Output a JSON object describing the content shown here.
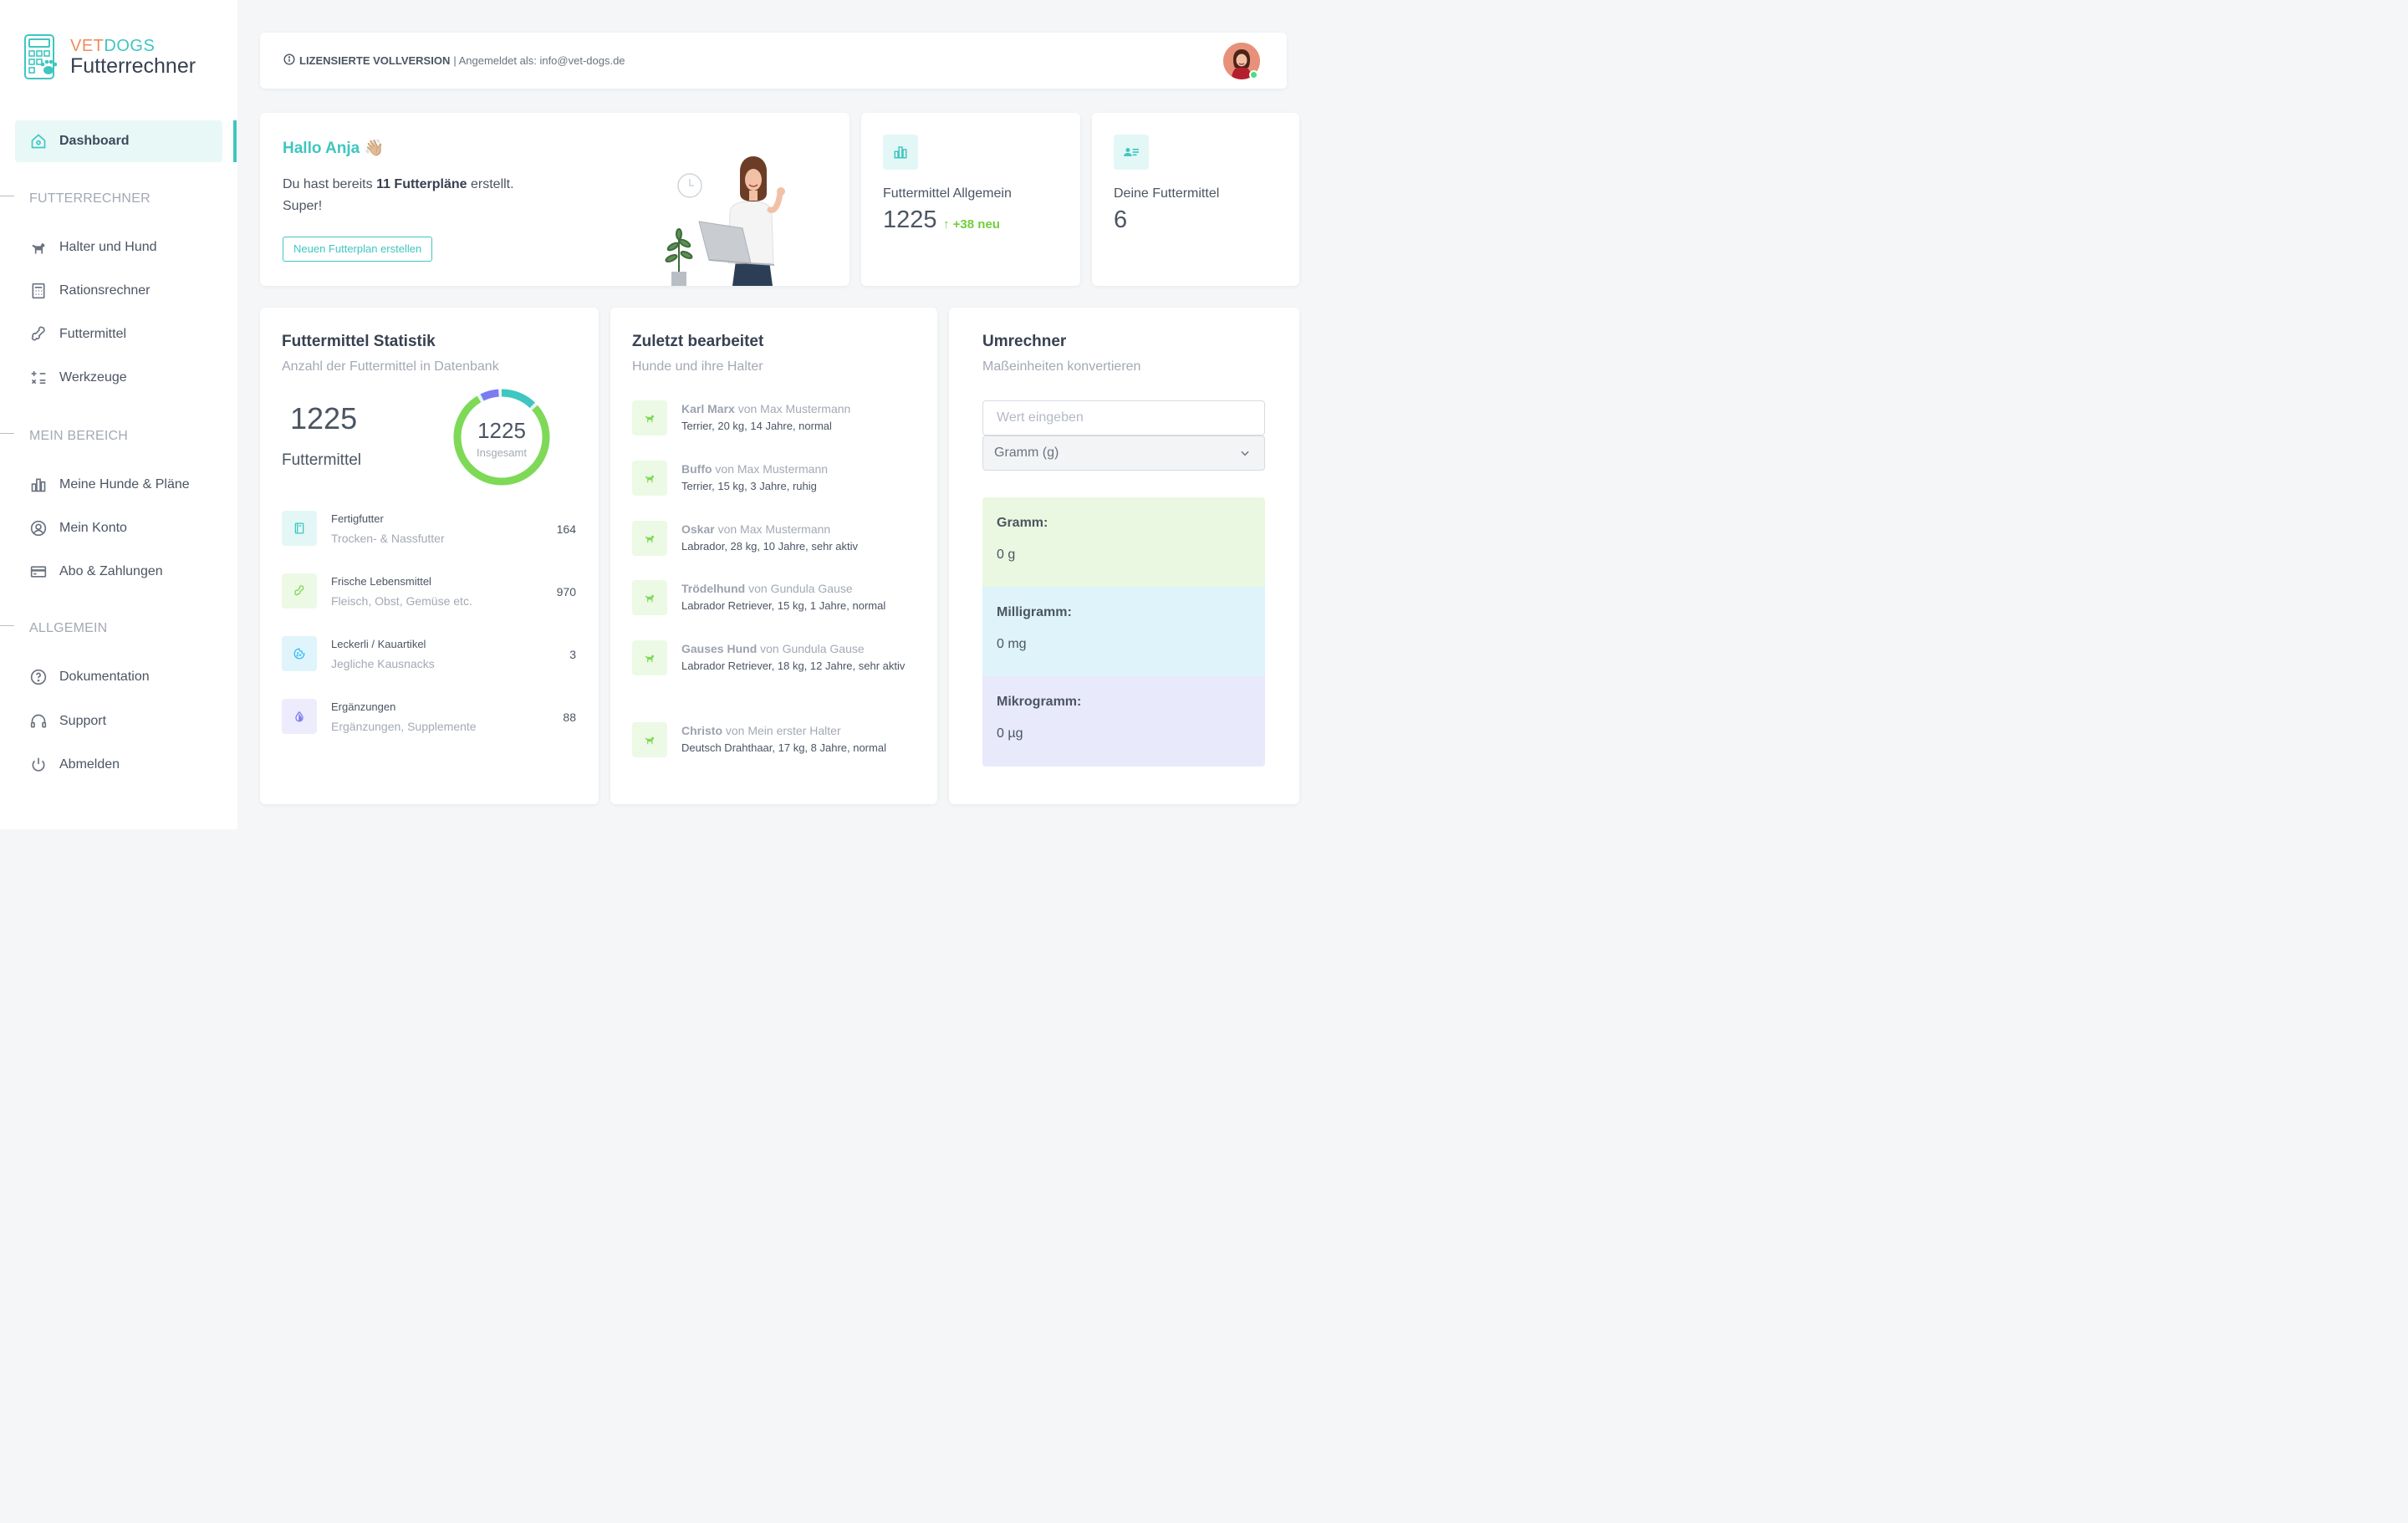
{
  "app": {
    "brand_vet": "VET",
    "brand_dogs": "DOGS",
    "brand_title": "Futterrechner"
  },
  "sidebar": {
    "dashboard_label": "Dashboard",
    "section_futterrechner": "FUTTERRECHNER",
    "section_mein_bereich": "MEIN BEREICH",
    "section_allgemein": "ALLGEMEIN",
    "items": [
      {
        "label": "Halter und Hund",
        "icon": "dog-icon"
      },
      {
        "label": "Rationsrechner",
        "icon": "calculator-icon"
      },
      {
        "label": "Futtermittel",
        "icon": "bone-icon"
      },
      {
        "label": "Werkzeuge",
        "icon": "math-tools-icon"
      },
      {
        "label": "Meine Hunde & Pläne",
        "icon": "bar-chart-icon"
      },
      {
        "label": "Mein Konto",
        "icon": "user-circle-icon"
      },
      {
        "label": "Abo & Zahlungen",
        "icon": "credit-card-icon"
      },
      {
        "label": "Dokumentation",
        "icon": "help-circle-icon"
      },
      {
        "label": "Support",
        "icon": "headset-icon"
      },
      {
        "label": "Abmelden",
        "icon": "power-icon"
      }
    ]
  },
  "topbar": {
    "license": "LIZENSIERTE VOLLVERSION",
    "login_text": "| Angemeldet als: info@vet-dogs.de"
  },
  "welcome": {
    "greeting": "Hallo Anja",
    "emoji": "👋🏼",
    "text_before": "Du hast bereits ",
    "text_bold": "11 Futterpläne",
    "text_after": " erstellt.",
    "text_line2": "Super!",
    "button": "Neuen Futterplan erstellen"
  },
  "stats": {
    "general_label": "Futtermittel Allgemein",
    "general_value": "1225",
    "general_delta": "+38 neu",
    "own_label": "Deine Futtermittel",
    "own_value": "6"
  },
  "statistik": {
    "title": "Futtermittel Statistik",
    "subtitle": "Anzahl der Futtermittel in Datenbank",
    "total": "1225",
    "total_label": "Futtermittel",
    "donut_total": "1225",
    "donut_label": "Insgesamt",
    "categories": [
      {
        "name": "Fertigfutter",
        "desc": "Trocken- & Nassfutter",
        "count": "164",
        "color": "#3fc6c0",
        "bg": "#e3f7f6",
        "icon": "book-icon"
      },
      {
        "name": "Frische Lebensmittel",
        "desc": "Fleisch, Obst, Gemüse etc.",
        "count": "970",
        "color": "#7ed957",
        "bg": "#ecf9e5",
        "icon": "bone-icon"
      },
      {
        "name": "Leckerli / Kauartikel",
        "desc": "Jegliche Kausnacks",
        "count": "3",
        "color": "#38bdf8",
        "bg": "#e0f4fb",
        "icon": "cookie-icon"
      },
      {
        "name": "Ergänzungen",
        "desc": "Ergänzungen, Supplemente",
        "count": "88",
        "color": "#7c7cf0",
        "bg": "#ececfd",
        "icon": "drop-icon"
      }
    ]
  },
  "recent": {
    "title": "Zuletzt bearbeitet",
    "subtitle": "Hunde und ihre Halter",
    "items": [
      {
        "dog": "Karl Marx",
        "owner": " von Max Mustermann",
        "details": "Terrier, 20 kg, 14 Jahre, normal"
      },
      {
        "dog": "Buffo",
        "owner": " von Max Mustermann",
        "details": "Terrier, 15 kg, 3 Jahre, ruhig"
      },
      {
        "dog": "Oskar",
        "owner": " von Max Mustermann",
        "details": "Labrador, 28 kg, 10 Jahre, sehr aktiv"
      },
      {
        "dog": "Trödelhund",
        "owner": " von Gundula Gause",
        "details": "Labrador Retriever, 15 kg, 1 Jahre, normal"
      },
      {
        "dog": "Gauses Hund",
        "owner": " von Gundula Gause",
        "details": "Labrador Retriever, 18 kg, 12 Jahre, sehr aktiv"
      },
      {
        "dog": "Christo",
        "owner": " von Mein erster Halter",
        "details": "Deutsch Drahthaar, 17 kg, 8 Jahre, normal"
      }
    ]
  },
  "converter": {
    "title": "Umrechner",
    "subtitle": "Maßeinheiten konvertieren",
    "input_placeholder": "Wert eingeben",
    "unit_selected": "Gramm (g)",
    "results": [
      {
        "label": "Gramm:",
        "value": "0 g",
        "bg": "#eaf8e1"
      },
      {
        "label": "Milligramm:",
        "value": "0 mg",
        "bg": "#dff4fa"
      },
      {
        "label": "Mikrogramm:",
        "value": "0 µg",
        "bg": "#e8e9fb"
      }
    ]
  },
  "colors": {
    "accent": "#3fc6c0",
    "success": "#6fcf3c"
  }
}
